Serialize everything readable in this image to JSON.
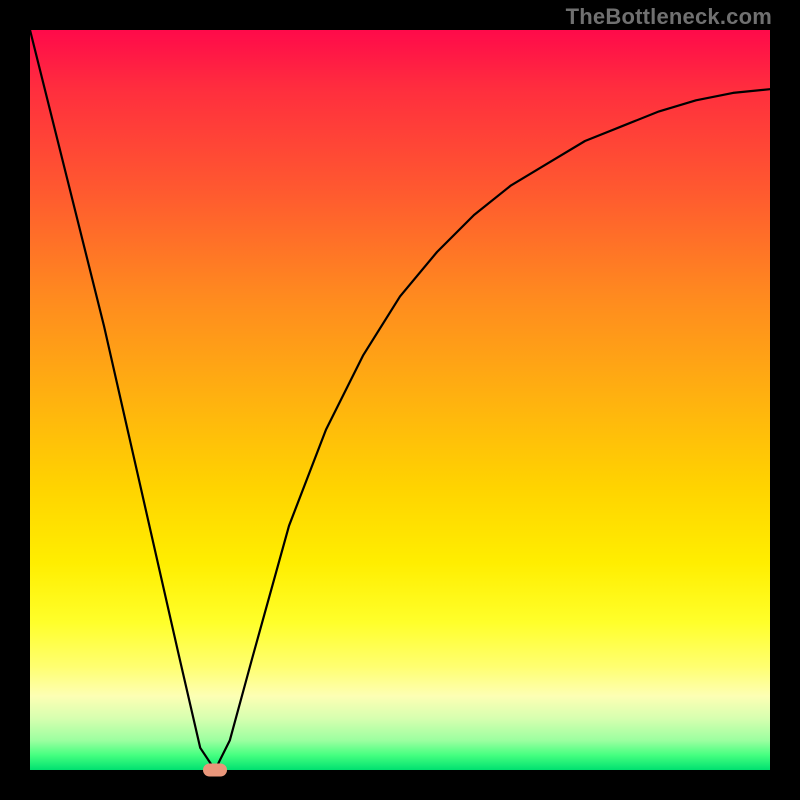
{
  "watermark": "TheBottleneck.com",
  "colors": {
    "frame": "#000000",
    "curve": "#000000",
    "marker": "#e9967a"
  },
  "chart_data": {
    "type": "line",
    "title": "",
    "xlabel": "",
    "ylabel": "",
    "xlim": [
      0,
      100
    ],
    "ylim": [
      0,
      100
    ],
    "grid": false,
    "legend": false,
    "series": [
      {
        "name": "bottleneck-curve",
        "x": [
          0,
          5,
          10,
          15,
          20,
          23,
          25,
          27,
          30,
          35,
          40,
          45,
          50,
          55,
          60,
          65,
          70,
          75,
          80,
          85,
          90,
          95,
          100
        ],
        "y": [
          100,
          80,
          60,
          38,
          16,
          3,
          0,
          4,
          15,
          33,
          46,
          56,
          64,
          70,
          75,
          79,
          82,
          85,
          87,
          89,
          90.5,
          91.5,
          92
        ]
      }
    ],
    "marker": {
      "x": 25,
      "y": 0
    },
    "gradient_stops": [
      {
        "pos": 0,
        "color": "#ff0a4a"
      },
      {
        "pos": 8,
        "color": "#ff2e3e"
      },
      {
        "pos": 22,
        "color": "#ff5a2f"
      },
      {
        "pos": 36,
        "color": "#ff8a1f"
      },
      {
        "pos": 50,
        "color": "#ffb20f"
      },
      {
        "pos": 62,
        "color": "#ffd400"
      },
      {
        "pos": 72,
        "color": "#ffee00"
      },
      {
        "pos": 80,
        "color": "#ffff2a"
      },
      {
        "pos": 86,
        "color": "#ffff70"
      },
      {
        "pos": 90,
        "color": "#fdffb4"
      },
      {
        "pos": 93,
        "color": "#d7ffb0"
      },
      {
        "pos": 96,
        "color": "#9cffa0"
      },
      {
        "pos": 98,
        "color": "#45ff80"
      },
      {
        "pos": 100,
        "color": "#00e070"
      }
    ]
  }
}
